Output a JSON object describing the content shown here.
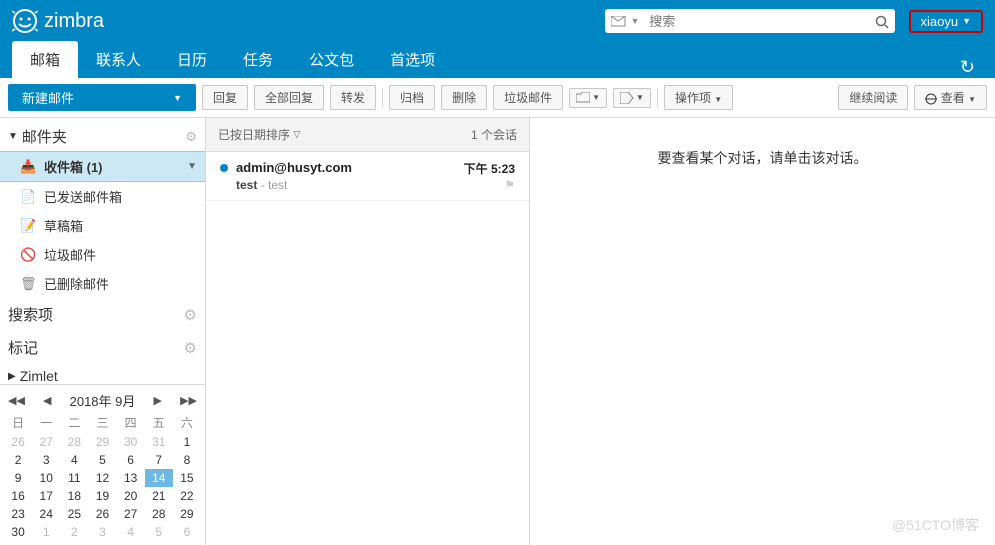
{
  "header": {
    "logo_text": "zimbra",
    "search_placeholder": "搜索",
    "user_name": "xiaoyu"
  },
  "nav": {
    "tabs": [
      "邮箱",
      "联系人",
      "日历",
      "任务",
      "公文包",
      "首选项"
    ],
    "active_index": 0
  },
  "toolbar": {
    "compose": "新建邮件",
    "reply": "回复",
    "reply_all": "全部回复",
    "forward": "转发",
    "archive": "归档",
    "delete": "删除",
    "spam": "垃圾邮件",
    "actions": "操作项",
    "continue_reading": "继续阅读",
    "view": "查看"
  },
  "sidebar": {
    "folders_header": "邮件夹",
    "folders": [
      {
        "name": "收件箱 (1)",
        "icon": "inbox",
        "active": true
      },
      {
        "name": "已发送邮件箱",
        "icon": "sent"
      },
      {
        "name": "草稿箱",
        "icon": "draft"
      },
      {
        "name": "垃圾邮件",
        "icon": "spam"
      },
      {
        "name": "已删除邮件",
        "icon": "trash"
      }
    ],
    "search_section": "搜索项",
    "tag_section": "标记",
    "zimlet_section": "Zimlet"
  },
  "calendar": {
    "title": "2018年 9月",
    "dow": [
      "日",
      "一",
      "二",
      "三",
      "四",
      "五",
      "六"
    ],
    "weeks": [
      [
        {
          "d": 26,
          "o": 1
        },
        {
          "d": 27,
          "o": 1
        },
        {
          "d": 28,
          "o": 1
        },
        {
          "d": 29,
          "o": 1
        },
        {
          "d": 30,
          "o": 1
        },
        {
          "d": 31,
          "o": 1
        },
        {
          "d": 1
        }
      ],
      [
        {
          "d": 2
        },
        {
          "d": 3
        },
        {
          "d": 4
        },
        {
          "d": 5
        },
        {
          "d": 6
        },
        {
          "d": 7
        },
        {
          "d": 8
        }
      ],
      [
        {
          "d": 9
        },
        {
          "d": 10
        },
        {
          "d": 11
        },
        {
          "d": 12
        },
        {
          "d": 13
        },
        {
          "d": 14,
          "t": 1
        },
        {
          "d": 15
        }
      ],
      [
        {
          "d": 16
        },
        {
          "d": 17
        },
        {
          "d": 18
        },
        {
          "d": 19
        },
        {
          "d": 20
        },
        {
          "d": 21
        },
        {
          "d": 22
        }
      ],
      [
        {
          "d": 23
        },
        {
          "d": 24
        },
        {
          "d": 25
        },
        {
          "d": 26
        },
        {
          "d": 27
        },
        {
          "d": 28
        },
        {
          "d": 29
        }
      ],
      [
        {
          "d": 30
        },
        {
          "d": 1,
          "o": 1
        },
        {
          "d": 2,
          "o": 1
        },
        {
          "d": 3,
          "o": 1
        },
        {
          "d": 4,
          "o": 1
        },
        {
          "d": 5,
          "o": 1
        },
        {
          "d": 6,
          "o": 1
        }
      ]
    ]
  },
  "list": {
    "sort_label": "已按日期排序",
    "count_label": "1 个会话",
    "messages": [
      {
        "from": "admin@husyt.com",
        "time": "下午 5:23",
        "subject": "test",
        "preview": "test",
        "unread": true
      }
    ]
  },
  "content": {
    "placeholder": "要查看某个对话，请单击该对话。"
  },
  "watermark": "@51CTO博客"
}
